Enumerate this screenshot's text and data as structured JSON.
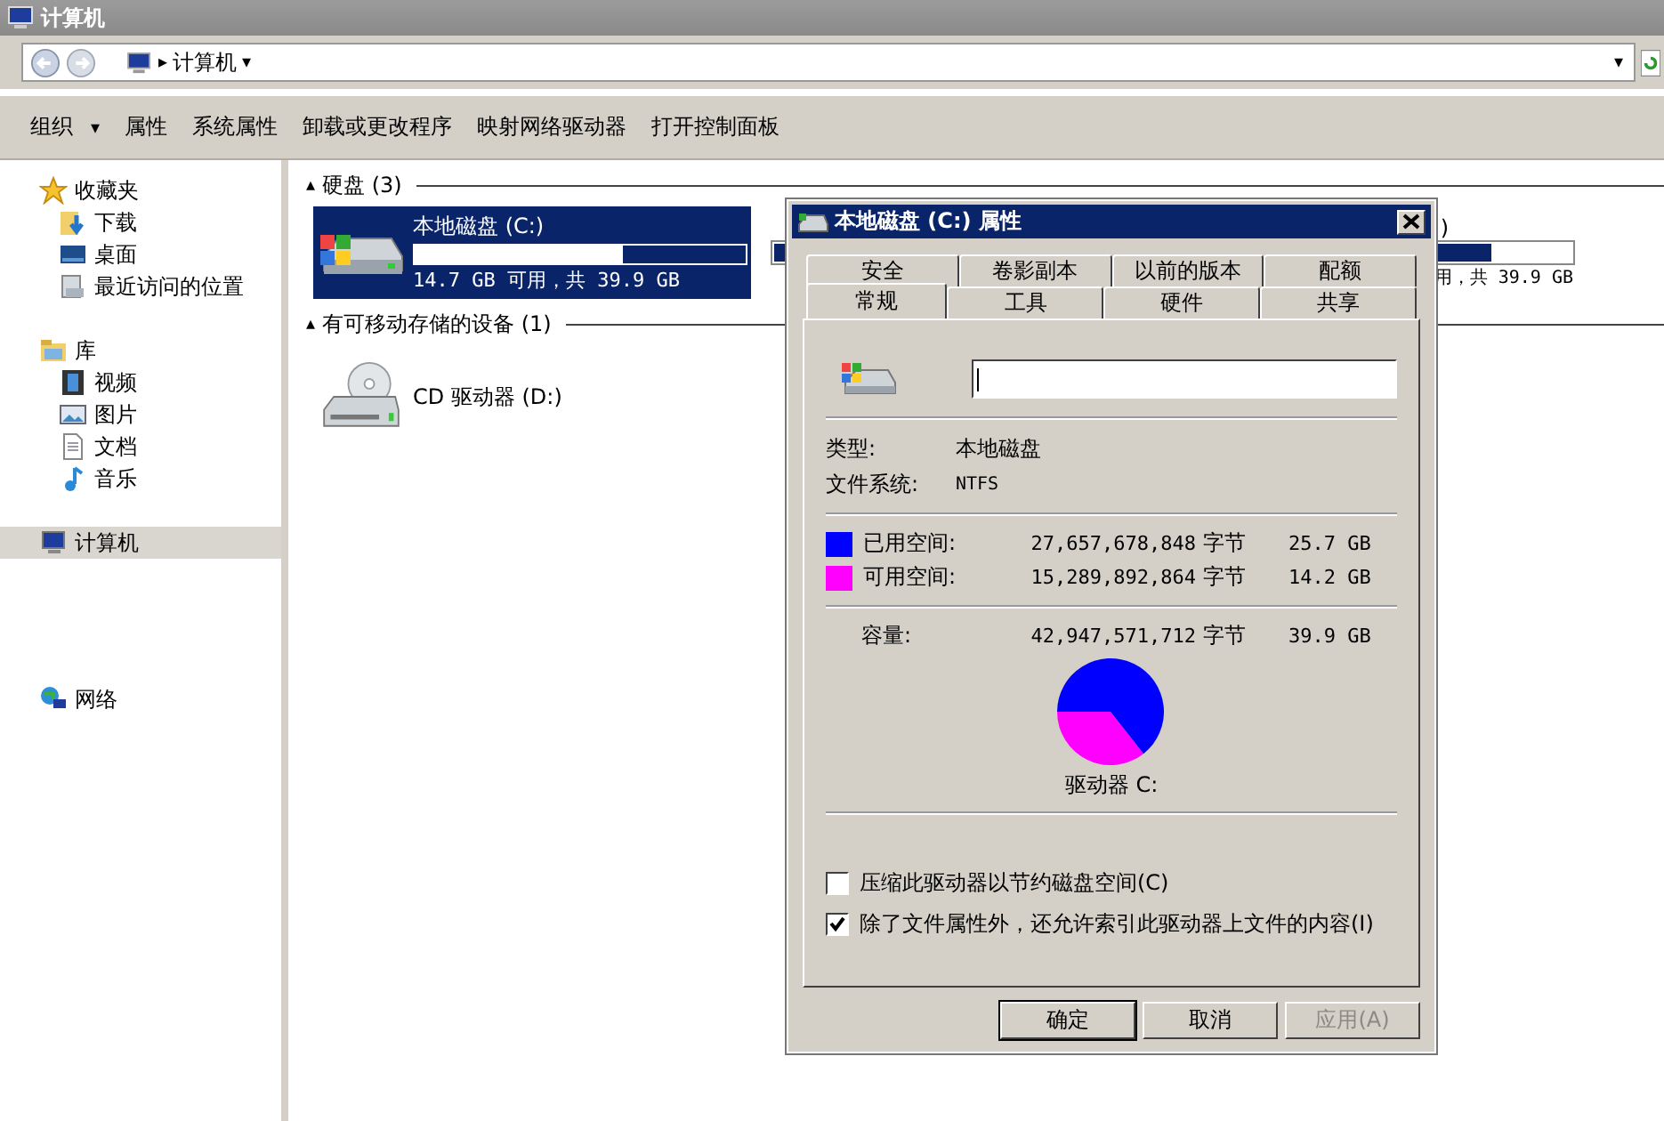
{
  "window": {
    "title": "计算机"
  },
  "address_bar": {
    "separator": "▸",
    "path": "计算机",
    "path_caret": "▾",
    "history_caret": "▾"
  },
  "toolbar": [
    {
      "label": "组织",
      "caret": "▾"
    },
    {
      "label": "属性"
    },
    {
      "label": "系统属性"
    },
    {
      "label": "卸载或更改程序"
    },
    {
      "label": "映射网络驱动器"
    },
    {
      "label": "打开控制面板"
    }
  ],
  "sidebar": {
    "groups": [
      {
        "label": "收藏夹",
        "kind": "star",
        "selected": false,
        "children": [
          {
            "label": "下载",
            "kind": "download",
            "selected": false
          },
          {
            "label": "桌面",
            "kind": "desktop",
            "selected": false
          },
          {
            "label": "最近访问的位置",
            "kind": "recent",
            "selected": false
          }
        ]
      },
      {
        "label": "库",
        "kind": "library",
        "selected": false,
        "children": [
          {
            "label": "视频",
            "kind": "video",
            "selected": false
          },
          {
            "label": "图片",
            "kind": "picture",
            "selected": false
          },
          {
            "label": "文档",
            "kind": "document",
            "selected": false
          },
          {
            "label": "音乐",
            "kind": "music",
            "selected": false
          }
        ]
      },
      {
        "label": "计算机",
        "kind": "computer",
        "selected": true
      },
      {
        "label": "网络",
        "kind": "network",
        "selected": false
      }
    ]
  },
  "content": {
    "groups": [
      {
        "toggle": "▴",
        "title": "硬盘 (3)",
        "items": [
          {
            "kind": "disk",
            "name": "本地磁盘 (C:)",
            "level": 0.63,
            "usage": "14.7 GB 可用，共 39.9 GB",
            "selected": true
          },
          {
            "kind": "disk",
            "name": ")",
            "level": 0.9,
            "usage": "用，共 39.9 GB",
            "selected": false
          }
        ]
      },
      {
        "toggle": "▴",
        "title": "有可移动存储的设备 (1)",
        "items": [
          {
            "kind": "cd",
            "name": "CD 驱动器 (D:)",
            "selected": false
          }
        ]
      }
    ]
  },
  "dialog": {
    "title": "本地磁盘 (C:) 属性",
    "tabs_back": [
      {
        "label": "安全",
        "selected": false
      },
      {
        "label": "卷影副本",
        "selected": false
      },
      {
        "label": "以前的版本",
        "selected": false
      },
      {
        "label": "配额",
        "selected": false
      }
    ],
    "tabs_front": [
      {
        "label": "常规",
        "selected": true
      },
      {
        "label": "工具",
        "selected": false
      },
      {
        "label": "硬件",
        "selected": false
      },
      {
        "label": "共享",
        "selected": false
      }
    ],
    "info": [
      {
        "label": "类型:",
        "value": "本地磁盘"
      },
      {
        "label": "文件系统:",
        "value": "NTFS"
      }
    ],
    "usage": [
      {
        "label": "已用空间:",
        "bytes": "27,657,678,848",
        "unit": "字节",
        "size": "25.7 GB",
        "color": "#0000ff"
      },
      {
        "label": "可用空间:",
        "bytes": "15,289,892,864",
        "unit": "字节",
        "size": "14.2 GB",
        "color": "#ff00ff"
      }
    ],
    "capacity": {
      "label": "容量:",
      "bytes": "42,947,571,712",
      "unit": "字节",
      "size": "39.9 GB"
    },
    "chart_data": {
      "type": "pie",
      "title": "驱动器 C:",
      "values": [
        64.4,
        35.6
      ]
    },
    "options": [
      {
        "label": "压缩此驱动器以节约磁盘空间(C)",
        "checked": false
      },
      {
        "label": "除了文件属性外，还允许索引此驱动器上文件的内容(I)",
        "checked": true
      }
    ],
    "buttons": [
      {
        "label": "确定",
        "default": true,
        "disabled": false
      },
      {
        "label": "取消",
        "default": false,
        "disabled": false
      },
      {
        "label": "应用(A)",
        "default": false,
        "disabled": true
      }
    ]
  }
}
